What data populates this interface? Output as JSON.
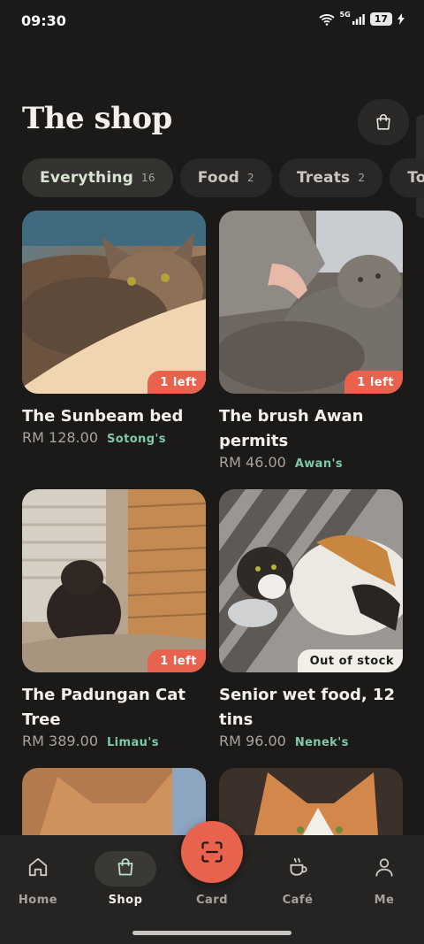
{
  "status": {
    "time": "09:30",
    "network": "5G",
    "battery": "17"
  },
  "header": {
    "title": "The shop",
    "cart_icon": "shopping-bag-icon"
  },
  "chips": [
    {
      "label": "Everything",
      "count": "16",
      "active": true
    },
    {
      "label": "Food",
      "count": "2"
    },
    {
      "label": "Treats",
      "count": "2"
    },
    {
      "label": "Toys",
      "count": ""
    }
  ],
  "products": [
    {
      "name": "The Sunbeam bed",
      "price": "RM 128.00",
      "seller": "Sotong's",
      "badge": "1 left"
    },
    {
      "name": "The brush Awan permits",
      "price": "RM 46.00",
      "seller": "Awan's",
      "badge": "1 left"
    },
    {
      "name": "The Padungan Cat Tree",
      "price": "RM 389.00",
      "seller": "Limau's",
      "badge": "1 left"
    },
    {
      "name": "Senior wet food, 12 tins",
      "price": "RM 96.00",
      "seller": "Nenek's",
      "badge": "Out of stock"
    }
  ],
  "nav": [
    {
      "label": "Home",
      "icon": "home-icon"
    },
    {
      "label": "Shop",
      "icon": "shopping-bag-icon",
      "active": true
    },
    {
      "label": "Card",
      "icon": "scan-icon"
    },
    {
      "label": "Café",
      "icon": "coffee-cup-icon"
    },
    {
      "label": "Me",
      "icon": "person-icon"
    }
  ],
  "colors": {
    "accent": "#e8624e",
    "seller": "#7fc9a9",
    "background": "#1b1a19"
  }
}
